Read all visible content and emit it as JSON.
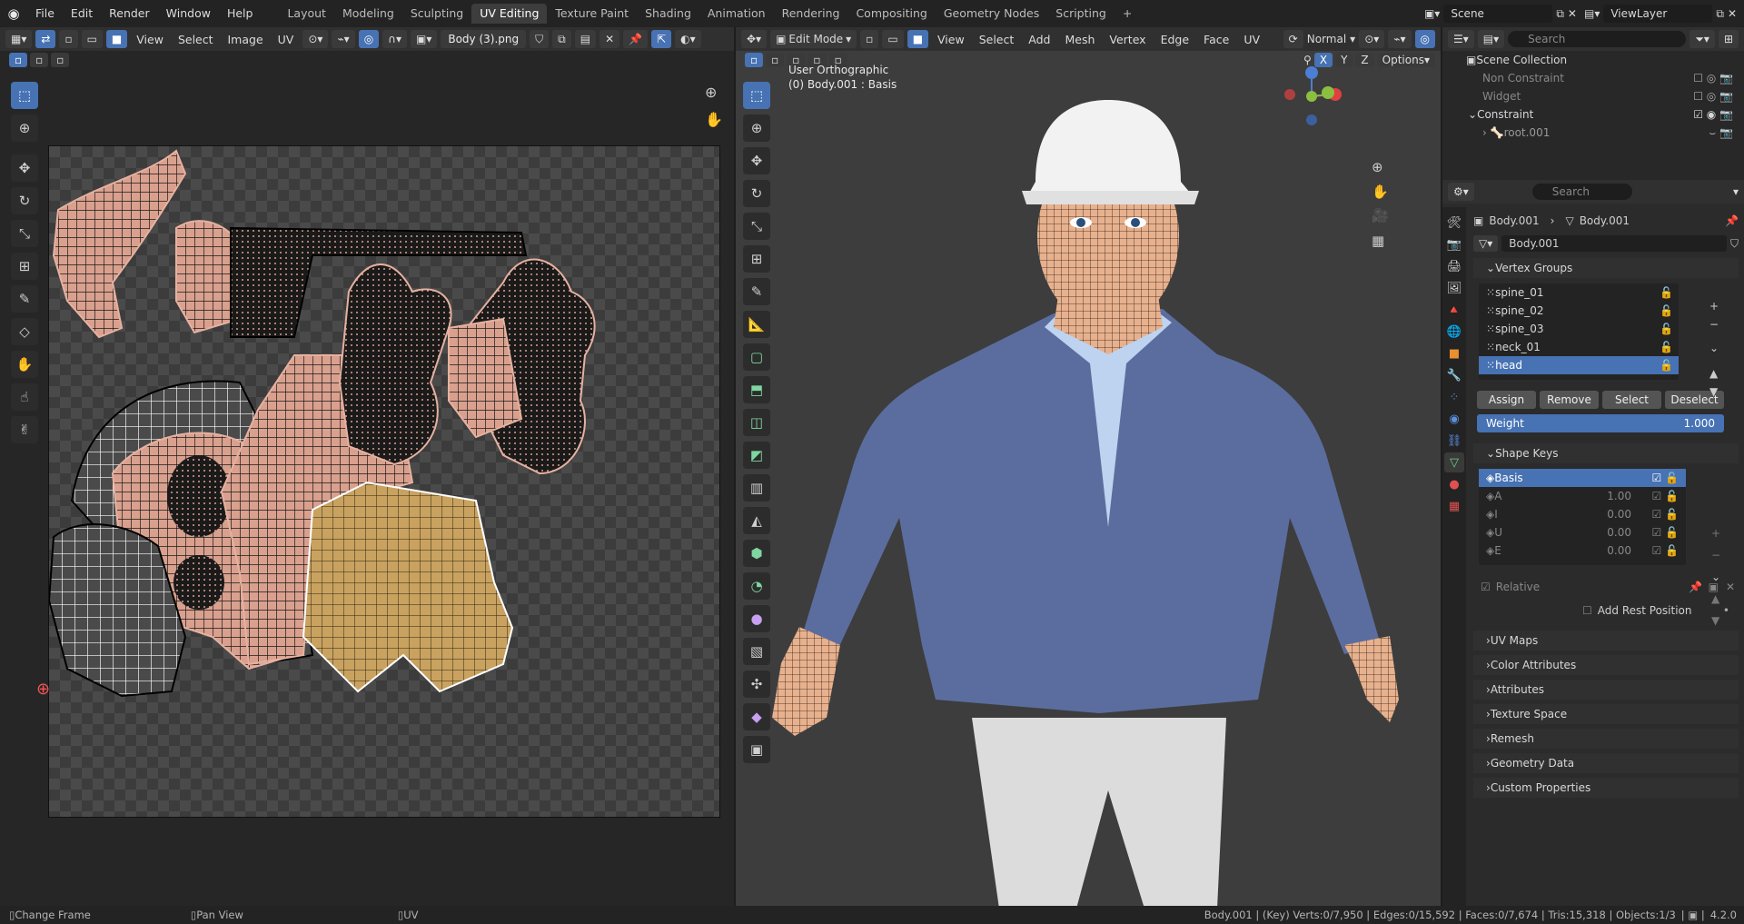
{
  "topbar": {
    "menus": [
      "File",
      "Edit",
      "Render",
      "Window",
      "Help"
    ],
    "workspaces": [
      "Layout",
      "Modeling",
      "Sculpting",
      "UV Editing",
      "Texture Paint",
      "Shading",
      "Animation",
      "Rendering",
      "Compositing",
      "Geometry Nodes",
      "Scripting"
    ],
    "active_workspace": "UV Editing",
    "scene": "Scene",
    "view_layer": "ViewLayer"
  },
  "uv_editor": {
    "menus": [
      "View",
      "Select",
      "Image",
      "UV"
    ],
    "image_name": "Body (3).png",
    "status_left": "Change Frame"
  },
  "viewport": {
    "mode": "Edit Mode",
    "menus": [
      "View",
      "Select",
      "Add",
      "Mesh",
      "Vertex",
      "Edge",
      "Face",
      "UV"
    ],
    "orientation": "Normal",
    "overlay_title": "User Orthographic",
    "overlay_sub": "(0) Body.001 : Basis",
    "axis_x": "X",
    "axis_y": "Y",
    "axis_z": "Z",
    "options": "Options",
    "status_mid": "Pan View"
  },
  "outliner": {
    "search_placeholder": "Search",
    "items": [
      "Scene Collection",
      "Non Constraint",
      "Widget",
      "Constraint",
      "root.001"
    ]
  },
  "properties": {
    "search_placeholder": "Search",
    "breadcrumb_object": "Body.001",
    "breadcrumb_data": "Body.001",
    "data_name": "Body.001",
    "vertex_groups_title": "Vertex Groups",
    "vertex_groups": [
      "spine_01",
      "spine_02",
      "spine_03",
      "neck_01",
      "head"
    ],
    "assign": "Assign",
    "remove": "Remove",
    "select": "Select",
    "deselect": "Deselect",
    "weight_label": "Weight",
    "weight_value": "1.000",
    "shape_keys_title": "Shape Keys",
    "shape_keys": [
      {
        "name": "Basis",
        "value": ""
      },
      {
        "name": "A",
        "value": "1.00"
      },
      {
        "name": "I",
        "value": "0.00"
      },
      {
        "name": "U",
        "value": "0.00"
      },
      {
        "name": "E",
        "value": "0.00"
      }
    ],
    "relative": "Relative",
    "add_rest": "Add Rest Position",
    "sections": [
      "UV Maps",
      "Color Attributes",
      "Attributes",
      "Texture Space",
      "Remesh",
      "Geometry Data",
      "Custom Properties"
    ]
  },
  "statusbar": {
    "left": "Change Frame",
    "mid": "Pan View",
    "uv": "UV",
    "stats": "Body.001 | (Key) Verts:0/7,950 | Edges:0/15,592 | Faces:0/7,674 | Tris:15,318 | Objects:1/3",
    "version": "4.2.0"
  }
}
